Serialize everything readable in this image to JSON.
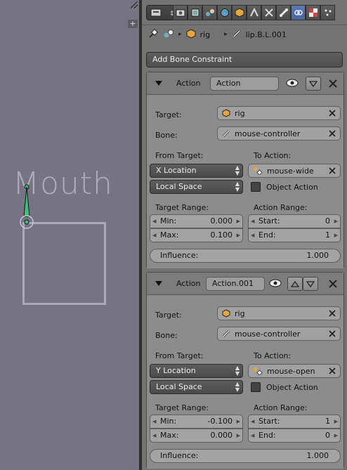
{
  "viewport": {
    "overlay_text": "Mouth"
  },
  "properties": {
    "context_tabs": [
      "render-icon",
      "render-layers-icon",
      "scene-icon",
      "world-icon",
      "object-icon",
      "constraints-icon",
      "modifiers-icon",
      "bone-icon",
      "bone-constraints-icon",
      "texture-icon",
      "particles-icon"
    ],
    "breadcrumb": {
      "armature": "rig",
      "bone": "lip.B.L.001"
    },
    "add_constraint_label": "Add Bone Constraint",
    "constraints": [
      {
        "kind_label": "Action",
        "name": "Action",
        "target_label": "Target:",
        "target": "rig",
        "bone_label": "Bone:",
        "bone": "mouse-controller",
        "from_target_label": "From Target:",
        "from_target": "X Location",
        "space": "Local Space",
        "to_action_label": "To Action:",
        "action": "mouse-wide",
        "object_action_label": "Object Action",
        "target_range_label": "Target Range:",
        "min_label": "Min:",
        "min": "0.000",
        "max_label": "Max:",
        "max": "0.100",
        "action_range_label": "Action Range:",
        "start_label": "Start:",
        "start": "0",
        "end_label": "End:",
        "end": "1",
        "influence_label": "Influence:",
        "influence": "1.000"
      },
      {
        "kind_label": "Action",
        "name": "Action.001",
        "target_label": "Target:",
        "target": "rig",
        "bone_label": "Bone:",
        "bone": "mouse-controller",
        "from_target_label": "From Target:",
        "from_target": "Y Location",
        "space": "Local Space",
        "to_action_label": "To Action:",
        "action": "mouse-open",
        "object_action_label": "Object Action",
        "target_range_label": "Target Range:",
        "min_label": "Min:",
        "min": "-0.100",
        "max_label": "Max:",
        "max": "0.000",
        "action_range_label": "Action Range:",
        "start_label": "Start:",
        "start": "1",
        "end_label": "End:",
        "end": "0",
        "influence_label": "Influence:",
        "influence": "1.000"
      }
    ]
  },
  "colors": {
    "active_tab": "#5a7ab5",
    "bone_green": "#3fbf7f"
  }
}
